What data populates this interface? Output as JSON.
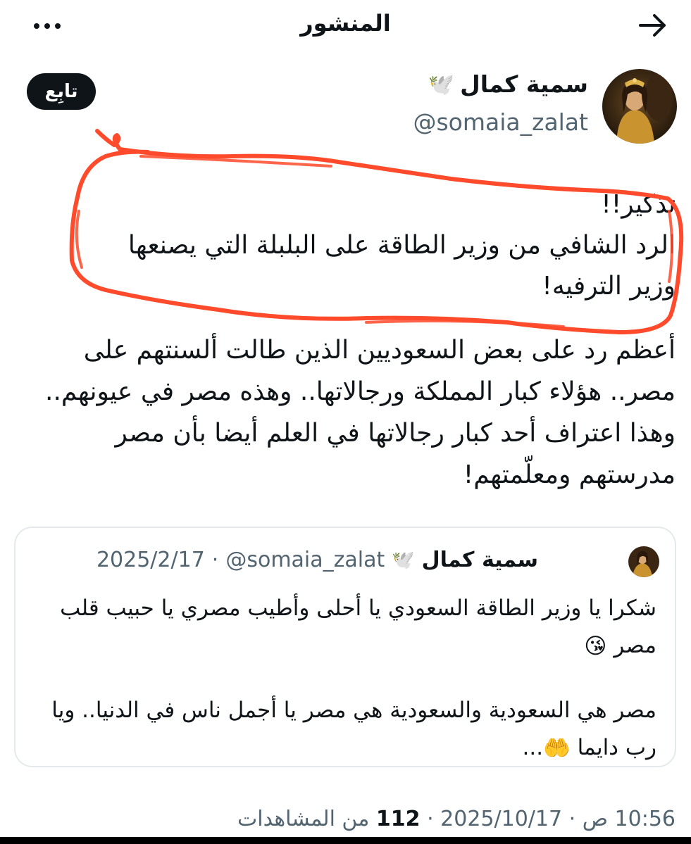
{
  "header": {
    "title": "المنشور",
    "back_icon": "arrow-right-icon",
    "more_icon": "more-horizontal-icon"
  },
  "author": {
    "name": "سمية كمال",
    "name_emoji": "🕊️",
    "handle": "@somaia_zalat",
    "follow_label": "تابِع"
  },
  "post": {
    "lines": [
      "تذكير!!",
      "الرد الشافي من وزير الطاقة على البلبلة التي يصنعها وزير الترفيه!"
    ],
    "body": "أعظم رد على بعض السعوديين الذين طالت ألسنتهم على مصر.. هؤلاء كبار المملكة ورجالاتها.. وهذه مصر في عيونهم.. وهذا اعتراف أحد كبار رجالاتها في العلم أيضا بأن مصر مدرستهم ومعلّمتهم!"
  },
  "quote": {
    "name": "سمية كمال",
    "name_emoji": "🕊️",
    "handle": "@somaia_zalat",
    "separator": "·",
    "date": "2025/2/17",
    "paragraph1": "شكرا يا وزير الطاقة السعودي يا أحلى وأطيب مصري يا حبيب قلب مصر",
    "paragraph1_emoji": "😘",
    "paragraph2": "مصر هي السعودية والسعودية هي مصر يا أجمل ناس في الدنيا.. ويا رب دايما",
    "paragraph2_emoji": "🤲",
    "paragraph2_tail": "..."
  },
  "meta": {
    "time": "10:56 ص",
    "separator": "·",
    "date": "2025/10/17",
    "views_count": "112",
    "views_label": "من المشاهدات"
  },
  "colors": {
    "text": "#0f1419",
    "secondary": "#536471",
    "scribble": "#ff4a2b",
    "border": "#e6e9ec"
  }
}
